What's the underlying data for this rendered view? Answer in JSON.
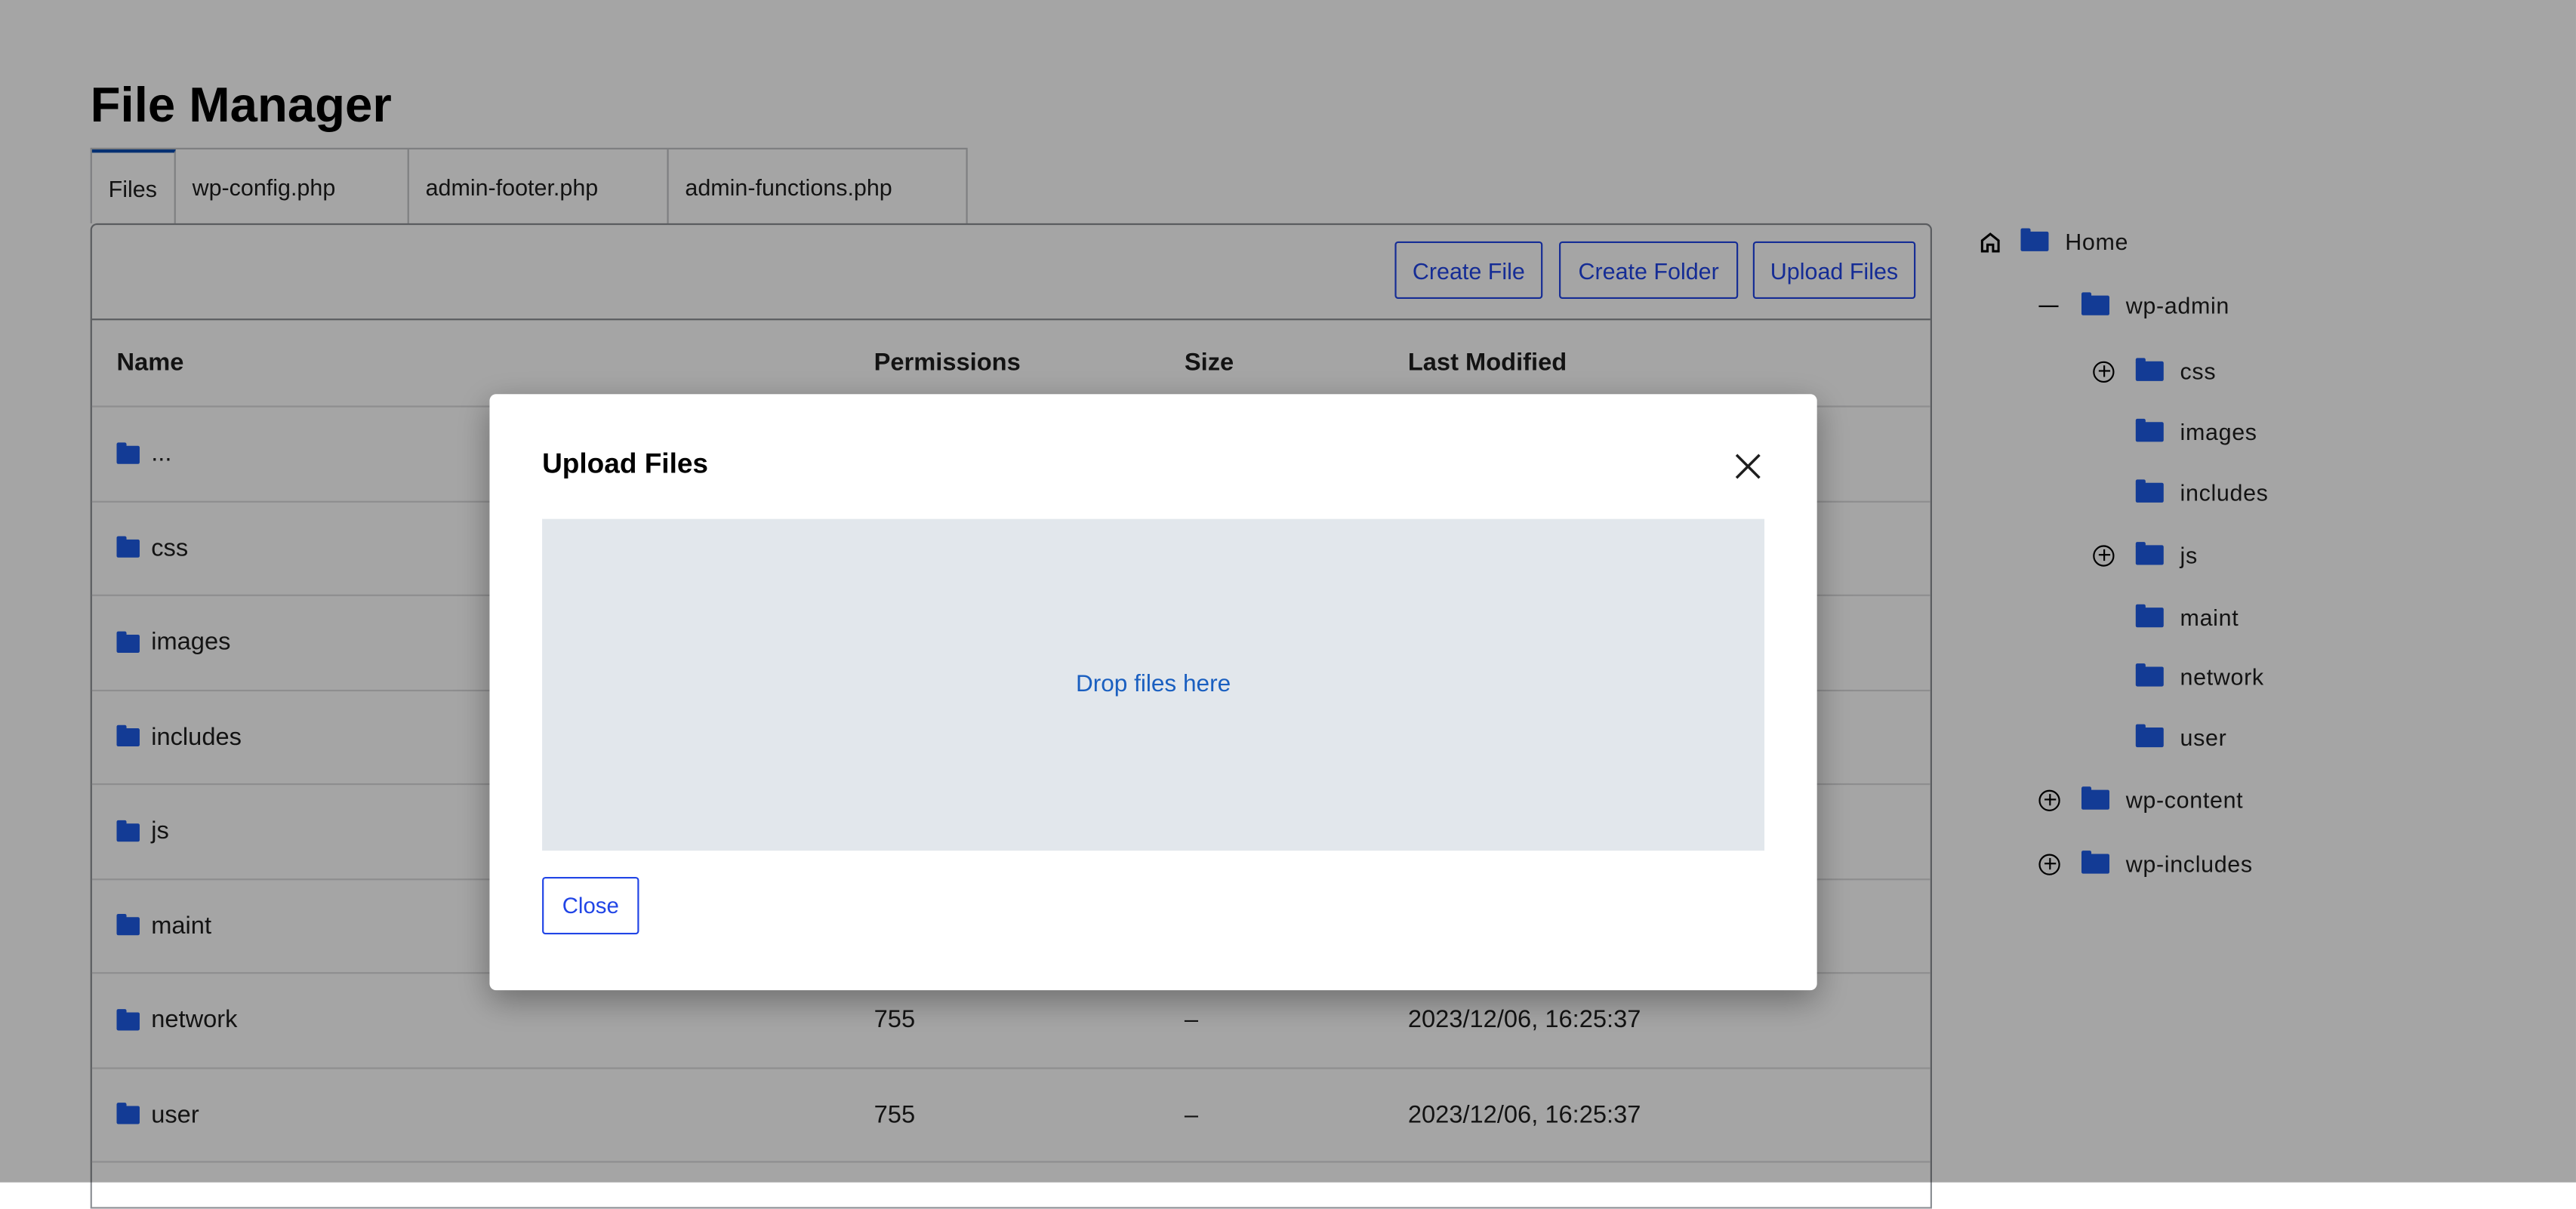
{
  "page_title": "File Manager",
  "tabs": [
    {
      "label": "Files",
      "active": true
    },
    {
      "label": "wp-config.php"
    },
    {
      "label": "admin-footer.php"
    },
    {
      "label": "admin-functions.php"
    }
  ],
  "toolbar": {
    "create_file": "Create File",
    "create_folder": "Create Folder",
    "upload_files": "Upload Files"
  },
  "table": {
    "headers": {
      "name": "Name",
      "permissions": "Permissions",
      "size": "Size",
      "modified": "Last Modified"
    },
    "rows": [
      {
        "name": "..."
      },
      {
        "name": "css"
      },
      {
        "name": "images"
      },
      {
        "name": "includes"
      },
      {
        "name": "js"
      },
      {
        "name": "maint"
      },
      {
        "name": "network",
        "permissions": "755",
        "size": "–",
        "modified": "2023/12/06, 16:25:37"
      },
      {
        "name": "user",
        "permissions": "755",
        "size": "–",
        "modified": "2023/12/06, 16:25:37"
      }
    ]
  },
  "tree": {
    "root": "Home",
    "items": [
      {
        "label": "wp-admin",
        "state": "expanded"
      },
      {
        "label": "css",
        "state": "collapsed"
      },
      {
        "label": "images"
      },
      {
        "label": "includes"
      },
      {
        "label": "js",
        "state": "collapsed"
      },
      {
        "label": "maint"
      },
      {
        "label": "network"
      },
      {
        "label": "user"
      },
      {
        "label": "wp-content",
        "state": "collapsed"
      },
      {
        "label": "wp-includes",
        "state": "collapsed"
      }
    ]
  },
  "modal": {
    "title": "Upload Files",
    "drop_text": "Drop files here",
    "close_label": "Close"
  },
  "colors": {
    "accent": "#2145e6",
    "folder": "#1e5ce6",
    "dropzone": "#e2e7ec",
    "drop_text": "#1a5fc0"
  }
}
